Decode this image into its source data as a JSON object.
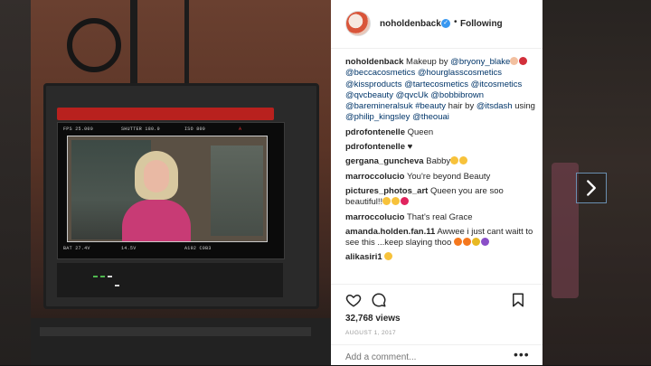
{
  "post": {
    "username": "noholdenback",
    "separator": "•",
    "follow_status": "Following",
    "comments": [
      {
        "user": "noholdenback",
        "parts": [
          {
            "t": "Makeup by "
          },
          {
            "t": "@bryony_blake",
            "m": true
          },
          {
            "emoji": [
              "#f2c0a0",
              "#d22f3a"
            ]
          },
          {
            "t": "@beccacosmetics",
            "m": true
          },
          {
            "t": " "
          },
          {
            "t": "@hourglasscosmetics",
            "m": true
          },
          {
            "t": " "
          },
          {
            "t": "@kissproducts",
            "m": true
          },
          {
            "t": " "
          },
          {
            "t": "@tartecosmetics",
            "m": true
          },
          {
            "t": " "
          },
          {
            "t": "@itcosmetics",
            "m": true
          },
          {
            "t": " "
          },
          {
            "t": "@qvcbeauty",
            "m": true
          },
          {
            "t": " "
          },
          {
            "t": "@qvcUk",
            "m": true
          },
          {
            "t": " "
          },
          {
            "t": "@bobbibrown",
            "m": true
          },
          {
            "t": " "
          },
          {
            "t": "@baremineralsuk",
            "m": true
          },
          {
            "t": " "
          },
          {
            "t": "#beauty",
            "m": true
          },
          {
            "t": " hair by "
          },
          {
            "t": "@itsdash",
            "m": true
          },
          {
            "t": " using "
          },
          {
            "t": "@philip_kingsley",
            "m": true
          },
          {
            "t": " "
          },
          {
            "t": "@theouai",
            "m": true
          }
        ]
      },
      {
        "user": "pdrofontenelle",
        "parts": [
          {
            "t": "Queen"
          }
        ]
      },
      {
        "user": "pdrofontenelle",
        "parts": [
          {
            "t": "♥"
          }
        ]
      },
      {
        "user": "gergana_guncheva",
        "parts": [
          {
            "t": "Babby"
          },
          {
            "emoji": [
              "#f7c23b",
              "#f7c23b"
            ]
          }
        ]
      },
      {
        "user": "marroccolucio",
        "parts": [
          {
            "t": "You're beyond Beauty"
          }
        ]
      },
      {
        "user": "pictures_photos_art",
        "parts": [
          {
            "t": "Queen you are soo beautiful!!"
          },
          {
            "emoji": [
              "#f7c23b",
              "#f7c23b",
              "#e0245e"
            ]
          }
        ]
      },
      {
        "user": "marroccolucio",
        "parts": [
          {
            "t": "That's real Grace"
          }
        ]
      },
      {
        "user": "amanda.holden.fan.11",
        "parts": [
          {
            "t": "Awwee i just cant waitt to see this ...keep slaying thoo "
          },
          {
            "emoji": [
              "#f5781e",
              "#f5781e",
              "#e8b923",
              "#8a4fc8"
            ]
          }
        ]
      },
      {
        "user": "alikasiri1",
        "parts": [
          {
            "emoji": [
              "#f7c23b"
            ]
          }
        ]
      }
    ],
    "views": "32,768 views",
    "date": "AUGUST 1, 2017",
    "add_comment_placeholder": "Add a comment...",
    "more_label": "•••"
  },
  "icons": {
    "like": "heart-icon",
    "comment": "comment-icon",
    "save": "bookmark-icon",
    "next": "chevron-right-icon",
    "verified": "verified-badge-icon"
  },
  "colors": {
    "mention": "#003569",
    "verified": "#3897f0",
    "border": "#efefef"
  }
}
